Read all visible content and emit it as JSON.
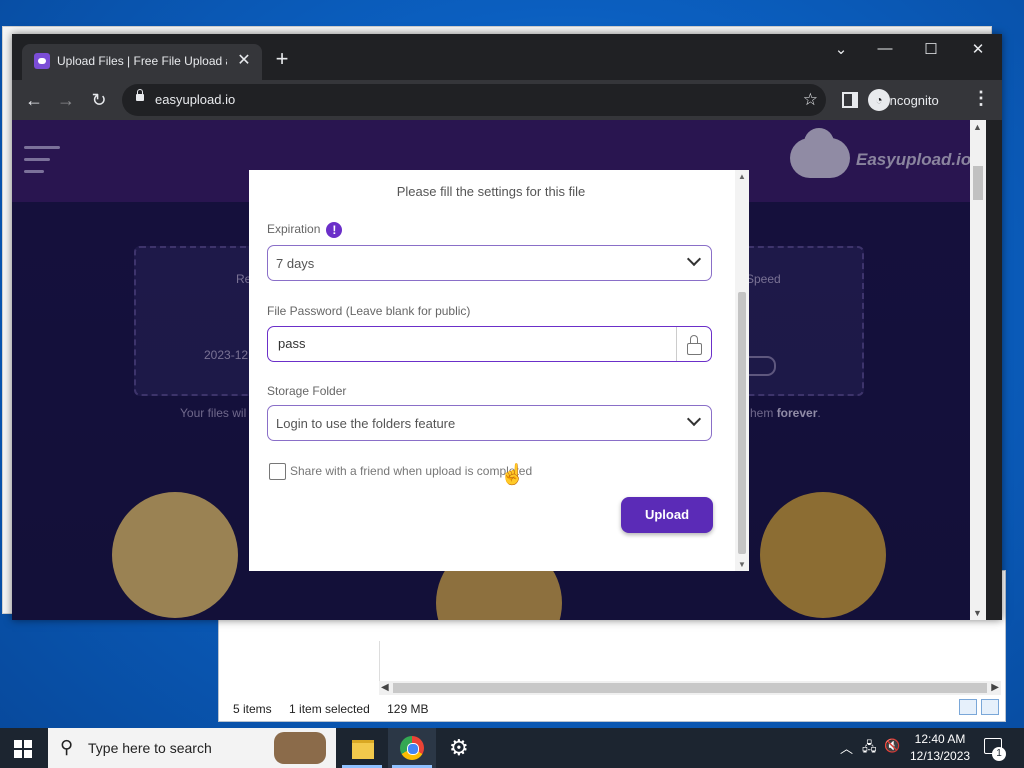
{
  "browser": {
    "tab_title": "Upload Files | Free File Upload a",
    "url": "easyupload.io",
    "profile_label": "Incognito"
  },
  "site": {
    "logo_text": "Easyupload.io",
    "bg_card_left_label": "Re",
    "bg_card_left_date": "2023-12",
    "bg_card_right_label": "Speed",
    "bg_note_left": "Your files wil",
    "bg_note_right_prefix": "hem ",
    "bg_note_right_bold": "forever",
    "bg_note_right_suffix": "."
  },
  "modal": {
    "subtitle": "Please fill the settings for this file",
    "expiration_label": "Expiration",
    "expiration_info_icon": "!",
    "expiration_value": "7 days",
    "password_label": "File Password (Leave blank for public)",
    "password_value": "pass",
    "storage_label": "Storage Folder",
    "storage_placeholder": "Login to use the folders feature",
    "share_label": "Share with a friend when upload is completed",
    "share_checked": false,
    "upload_button": "Upload"
  },
  "explorer": {
    "items_count": "5 items",
    "selected": "1 item selected",
    "size": "129 MB"
  },
  "taskbar": {
    "search_placeholder": "Type here to search",
    "time": "12:40 AM",
    "date": "12/13/2023",
    "notification_count": "1"
  },
  "colors": {
    "accent_purple": "#5b2bb7",
    "site_header": "#3b1c66",
    "taskbar": "#1c2530"
  }
}
